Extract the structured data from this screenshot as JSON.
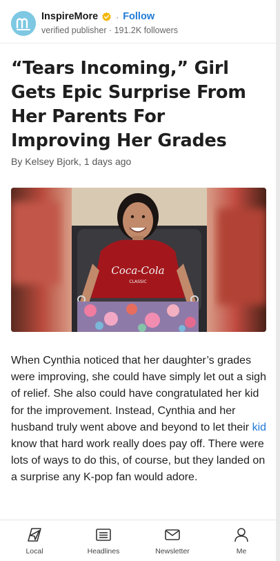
{
  "publisher": {
    "name": "InspireMore",
    "follow_label": "Follow",
    "separator": "·",
    "meta": "verified publisher · 191.2K followers"
  },
  "article": {
    "title": "“Tears Incoming,” Girl Gets Epic Surprise From Her Parents For Improving Her Grades",
    "byline": "By Kelsey Bjork, 1 days ago",
    "shirt_text_1": "Coca-Cola",
    "shirt_text_2": "CLASSIC",
    "body_before_link": "When Cynthia noticed that her daughter’s grades were improving, she could have simply let out a sigh of relief. She also could have congratulated her kid for the improvement. Instead, Cynthia and her husband truly went above and beyond to let their ",
    "body_link": "kid",
    "body_after_link": " know that hard work really does pay off. There were lots of ways to do this, of course, but they landed on a surprise any K-pop fan would adore."
  },
  "nav": {
    "items": [
      {
        "label": "Local",
        "icon": "location-arrow-icon"
      },
      {
        "label": "Headlines",
        "icon": "newspaper-icon"
      },
      {
        "label": "Newsletter",
        "icon": "envelope-icon"
      },
      {
        "label": "Me",
        "icon": "person-icon"
      }
    ]
  },
  "colors": {
    "accent": "#1f7ad6",
    "avatar_bg": "#7ec8e3",
    "verified_badge": "#f2b705"
  }
}
